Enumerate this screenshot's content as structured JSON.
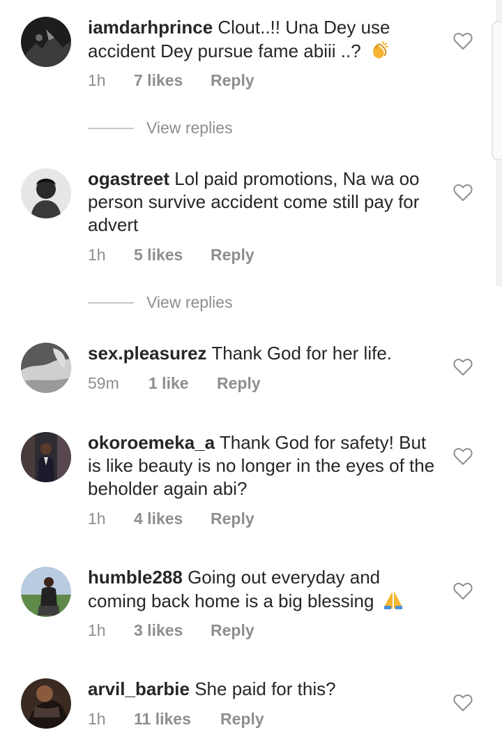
{
  "comments": [
    {
      "username": "iamdarhprince",
      "text": "Clout..!! Una Dey use accident Dey pursue fame abiii ..? ",
      "emoji": "clapping-hands",
      "time": "1h",
      "likes": "7 likes",
      "reply": "Reply",
      "view_replies": "View replies"
    },
    {
      "username": "ogastreet",
      "text": "Lol paid promotions, Na wa oo person survive accident come still pay for advert",
      "time": "1h",
      "likes": "5 likes",
      "reply": "Reply",
      "view_replies": "View replies"
    },
    {
      "username": "sex.pleasurez",
      "text": "Thank God for her life.",
      "time": "59m",
      "likes": "1 like",
      "reply": "Reply"
    },
    {
      "username": "okoroemeka_a",
      "text": "Thank God for safety! But is like beauty is no longer in the eyes of the beholder again abi?",
      "time": "1h",
      "likes": "4 likes",
      "reply": "Reply"
    },
    {
      "username": "humble288",
      "text": "Going out everyday and coming back home is a big blessing ",
      "emoji": "folded-hands",
      "time": "1h",
      "likes": "3 likes",
      "reply": "Reply"
    },
    {
      "username": "arvil_barbie",
      "text": "She paid for this?",
      "time": "1h",
      "likes": "11 likes",
      "reply": "Reply"
    }
  ],
  "colors": {
    "text": "#262626",
    "secondary": "#8e8e8e",
    "divider": "#c7c7c7",
    "heart_stroke": "#8e8e8e"
  }
}
